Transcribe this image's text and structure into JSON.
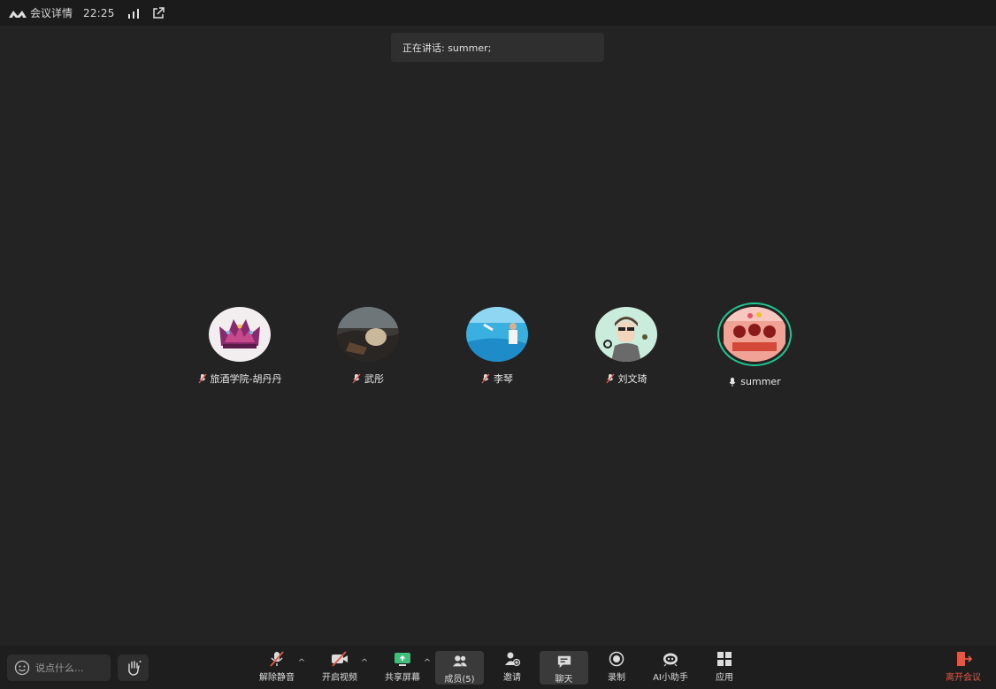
{
  "topbar": {
    "title": "会议详情",
    "time": "22:25"
  },
  "speaking": {
    "text": "正在讲话: summer;"
  },
  "participants": [
    {
      "name": "旅酒学院-胡丹丹",
      "muted": true,
      "avatar": "crown-avatar"
    },
    {
      "name": "武彤",
      "muted": true,
      "avatar": "rock-avatar"
    },
    {
      "name": "李琴",
      "muted": true,
      "avatar": "pool-avatar"
    },
    {
      "name": "刘文琦",
      "muted": true,
      "avatar": "cartoon-man-avatar"
    },
    {
      "name": "summer",
      "muted": false,
      "speaking": true,
      "avatar": "red-cartoon-avatar"
    }
  ],
  "toolbar": {
    "chat_placeholder": "说点什么...",
    "unmute": "解除静音",
    "start_video": "开启视频",
    "share_screen": "共享屏幕",
    "members": "成员(5)",
    "invite": "邀请",
    "chat": "聊天",
    "record": "录制",
    "ai_assistant": "AI小助手",
    "apps": "应用",
    "leave": "离开会议"
  },
  "colors": {
    "background": "#232323",
    "active_speaker_ring": "#1fc58e",
    "leave_red": "#e55745"
  }
}
